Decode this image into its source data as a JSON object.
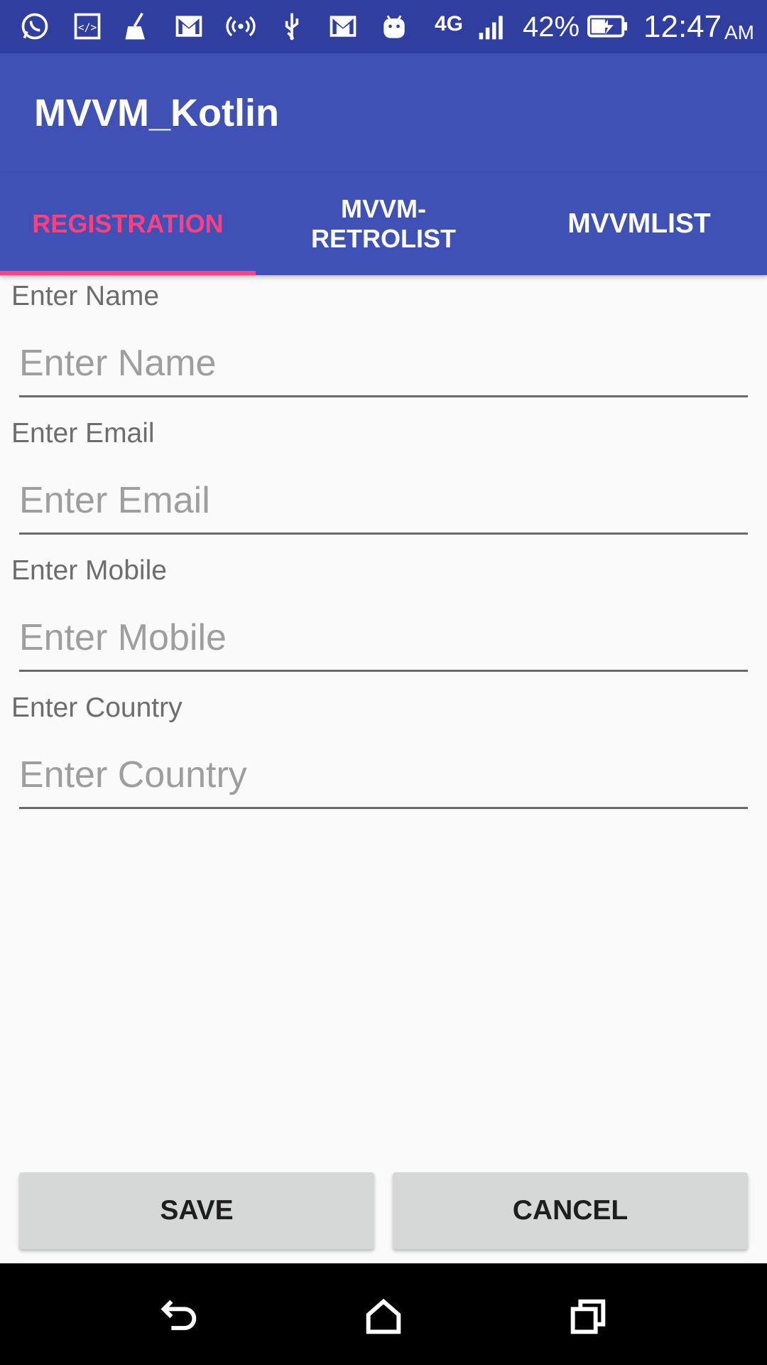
{
  "status_bar": {
    "icons": [
      "whatsapp-icon",
      "code-icon",
      "cleaner-icon",
      "gmail-icon",
      "hotspot-icon",
      "usb-icon",
      "gmail-icon",
      "android-icon"
    ],
    "network": "4G",
    "battery": "42%",
    "time": "12:47",
    "ampm": "AM"
  },
  "app": {
    "title": "MVVM_Kotlin"
  },
  "tabs": [
    {
      "label": "REGISTRATION",
      "active": true
    },
    {
      "label": "MVVM-\nRETROLIST",
      "active": false
    },
    {
      "label": "MVVMLIST",
      "active": false
    }
  ],
  "form": {
    "fields": [
      {
        "label": "Enter Name",
        "placeholder": "Enter Name",
        "value": ""
      },
      {
        "label": "Enter Email",
        "placeholder": "Enter Email",
        "value": ""
      },
      {
        "label": "Enter Mobile",
        "placeholder": "Enter Mobile",
        "value": ""
      },
      {
        "label": "Enter Country",
        "placeholder": "Enter Country",
        "value": ""
      }
    ]
  },
  "buttons": {
    "save": "SAVE",
    "cancel": "CANCEL"
  },
  "nav": {
    "icons": [
      "back-icon",
      "home-icon",
      "recents-icon"
    ]
  },
  "colors": {
    "primary": "#3f51b5",
    "primary_dark": "#303f9f",
    "accent": "#ff4081"
  }
}
